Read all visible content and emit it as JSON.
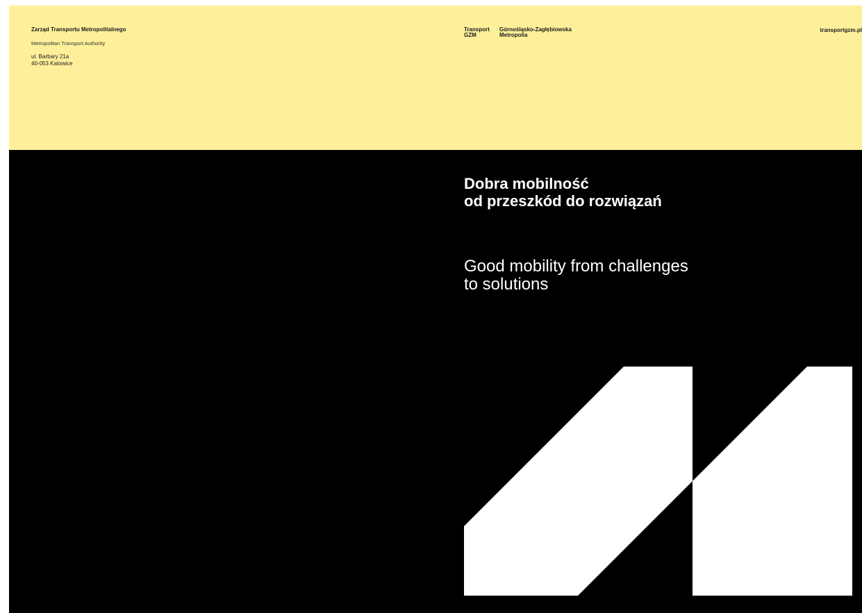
{
  "colors": {
    "top_band": "#fef09a",
    "bottom_band": "#000000",
    "logo": "#ffffff"
  },
  "header": {
    "org_name": "Zarząd Transportu Metropolitalnego",
    "org_name_en": "Metropolitan Transport Authority",
    "address_line1": "ul. Barbary 21a",
    "address_line2": "40-053 Katowice",
    "brand_col1_line1": "Transport",
    "brand_col1_line2": "GZM",
    "brand_col2_line1": "Górnośląsko-Zagłębiowska",
    "brand_col2_line2": "Metropolia",
    "website": "transportgzm.pl"
  },
  "main": {
    "title_pl_line1": "Dobra mobilność",
    "title_pl_line2": "od przeszkód do rozwiązań",
    "title_en_line1": "Good mobility from challenges",
    "title_en_line2": "to solutions"
  },
  "logo": {
    "icon": "gzm-metropolis-logo-icon"
  }
}
